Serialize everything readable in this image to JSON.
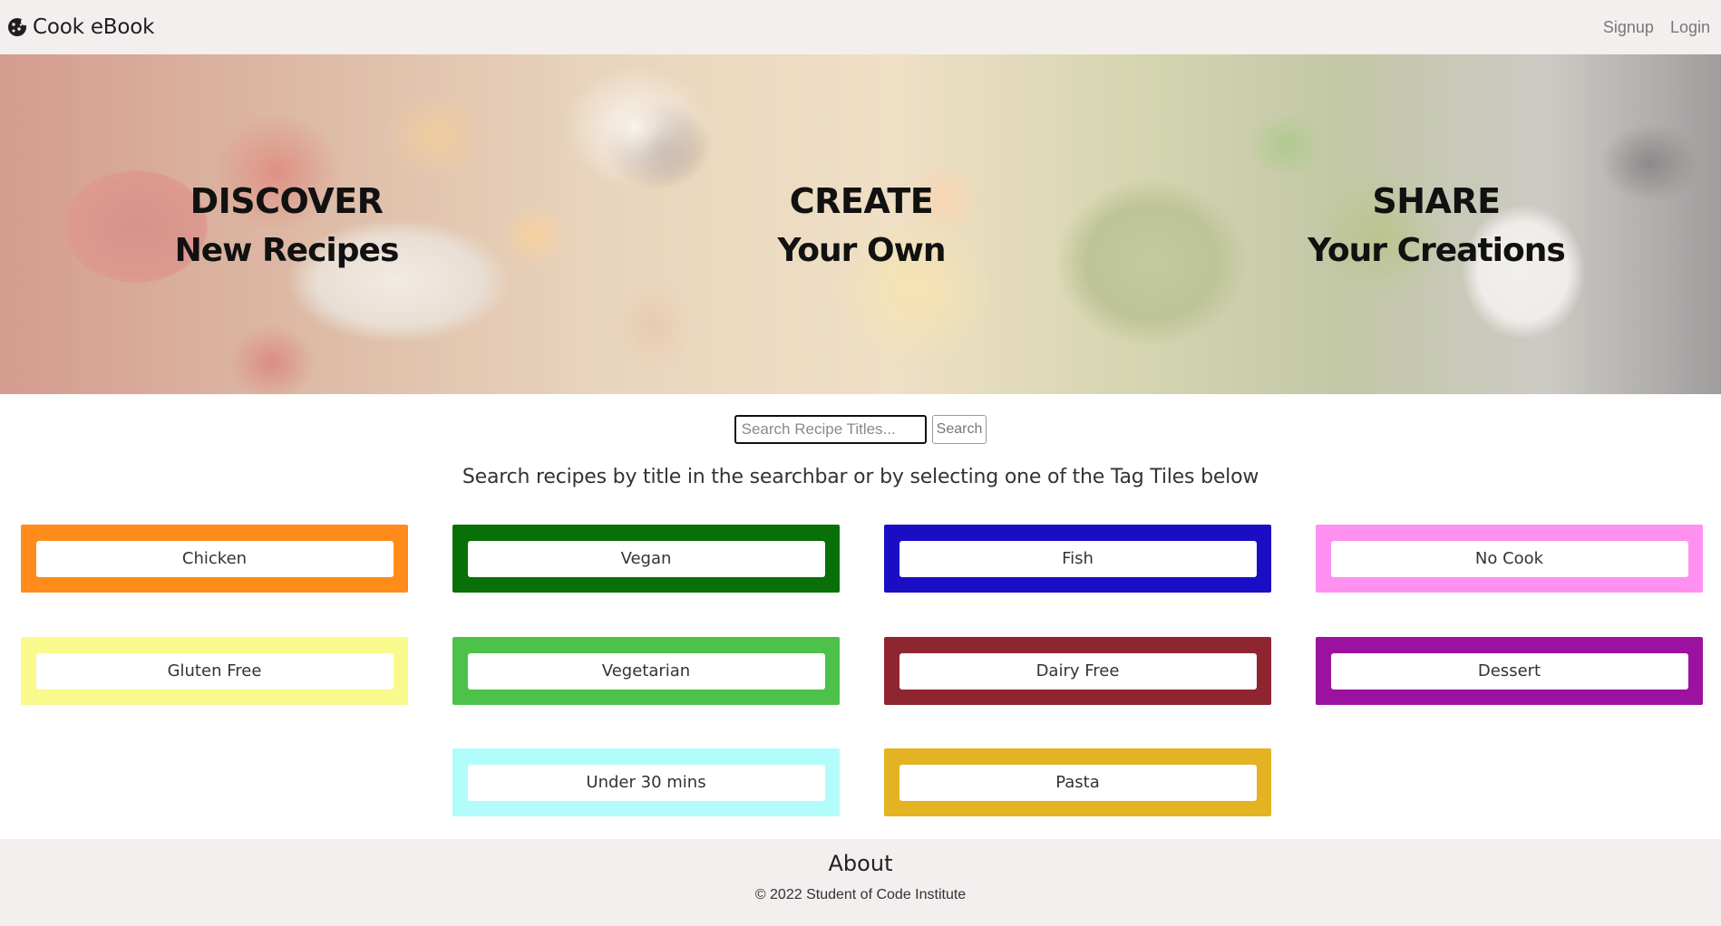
{
  "navbar": {
    "brand": "Cook eBook",
    "brand_icon": "cookie-icon",
    "signup_label": "Signup",
    "login_label": "Login"
  },
  "hero": {
    "blocks": [
      {
        "title": "DISCOVER",
        "subtitle": "New Recipes"
      },
      {
        "title": "CREATE",
        "subtitle": "Your Own"
      },
      {
        "title": "SHARE",
        "subtitle": "Your Creations"
      }
    ]
  },
  "search": {
    "placeholder": "Search Recipe Titles...",
    "value": "",
    "button_label": "Search",
    "instructions": "Search recipes by title in the searchbar or by selecting one of the Tag Tiles below"
  },
  "tags": [
    {
      "label": "Chicken",
      "color": "#ff8c1a"
    },
    {
      "label": "Vegan",
      "color": "#087006"
    },
    {
      "label": "Fish",
      "color": "#1a0ec4"
    },
    {
      "label": "No Cook",
      "color": "#ff90f0"
    },
    {
      "label": "Gluten Free",
      "color": "#fafa8c"
    },
    {
      "label": "Vegetarian",
      "color": "#4cc24a"
    },
    {
      "label": "Dairy Free",
      "color": "#8f2530"
    },
    {
      "label": "Dessert",
      "color": "#9c12a0"
    },
    {
      "label": "Under 30 mins",
      "color": "#b3fcfc"
    },
    {
      "label": "Pasta",
      "color": "#e3b322"
    }
  ],
  "footer": {
    "about_label": "About",
    "copyright": "© 2022 Student of Code Institute"
  }
}
